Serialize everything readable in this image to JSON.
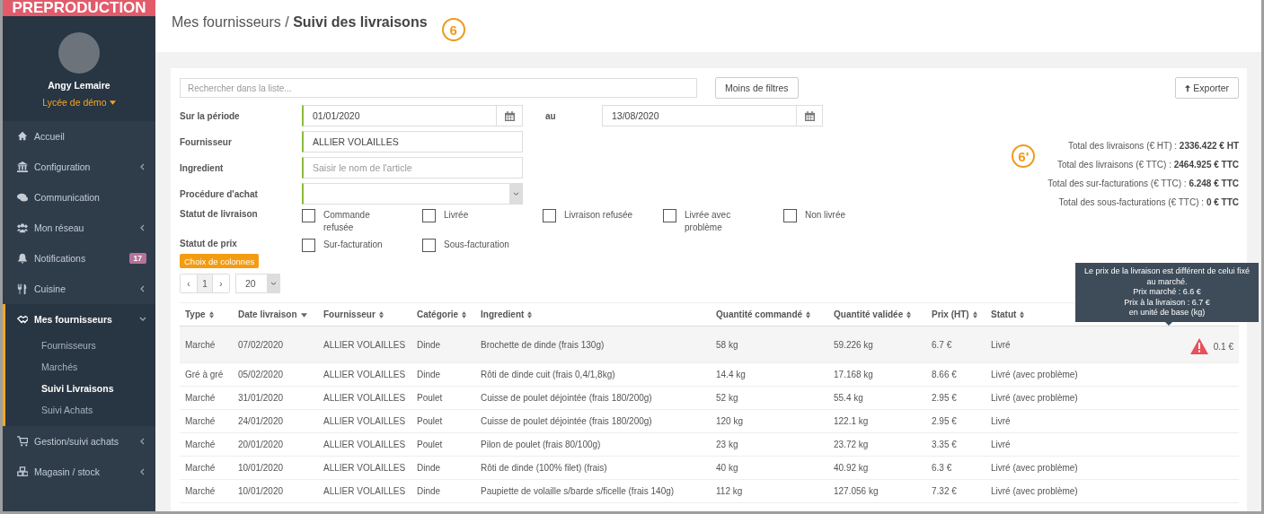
{
  "env_banner": "PREPRODUCTION",
  "user": {
    "name": "Angy Lemaire",
    "school": "Lycée de démo"
  },
  "sidebar": {
    "items": [
      {
        "kind": "home",
        "label": "Accueil",
        "has_submenu": false,
        "expanded": false
      },
      {
        "kind": "bank",
        "label": "Configuration",
        "has_submenu": true,
        "expanded": false
      },
      {
        "kind": "chat",
        "label": "Communication",
        "has_submenu": false,
        "expanded": false
      },
      {
        "kind": "users",
        "label": "Mon réseau",
        "has_submenu": true,
        "expanded": false
      },
      {
        "kind": "bell",
        "label": "Notifications",
        "has_submenu": false,
        "expanded": false,
        "badge": "17"
      },
      {
        "kind": "cutlery",
        "label": "Cuisine",
        "has_submenu": true,
        "expanded": false
      },
      {
        "kind": "handshake",
        "label": "Mes fournisseurs",
        "has_submenu": true,
        "expanded": true,
        "children": [
          {
            "label": "Fournisseurs",
            "selected": false
          },
          {
            "label": "Marchés",
            "selected": false
          },
          {
            "label": "Suivi Livraisons",
            "selected": true
          },
          {
            "label": "Suivi Achats",
            "selected": false
          }
        ]
      },
      {
        "kind": "cart",
        "label": "Gestion/suivi achats",
        "has_submenu": true,
        "expanded": false
      },
      {
        "kind": "cubes",
        "label": "Magasin / stock",
        "has_submenu": true,
        "expanded": false
      }
    ]
  },
  "breadcrumb": {
    "parent": "Mes fournisseurs / ",
    "current": "Suivi des livraisons"
  },
  "callouts": [
    "6",
    "6'"
  ],
  "search": {
    "placeholder": "Rechercher dans la liste..."
  },
  "filter_toggle": "Moins de filtres",
  "export_button": "Exporter",
  "filters": {
    "period_label": "Sur la période",
    "from": "01/01/2020",
    "to_label": "au",
    "to": "13/08/2020",
    "supplier_label": "Fournisseur",
    "supplier": "ALLIER VOLAILLES",
    "ingredient_label": "Ingredient",
    "ingredient_placeholder": "Saisir le nom de l'article",
    "procedure_label": "Procédure d'achat",
    "delivery_status_label": "Statut de livraison",
    "delivery_statuses": [
      {
        "label": "Commande refusée",
        "checked": false
      },
      {
        "label": "Livrée",
        "checked": false
      },
      {
        "label": "Livraison refusée",
        "checked": false
      },
      {
        "label": "Livrée avec problème",
        "checked": false
      },
      {
        "label": "Non livrée",
        "checked": false
      }
    ],
    "price_status_label": "Statut de prix",
    "price_statuses": [
      {
        "label": "Sur-facturation",
        "checked": false
      },
      {
        "label": "Sous-facturation",
        "checked": false
      }
    ]
  },
  "totals": [
    {
      "label": "Total des livraisons (€ HT) : ",
      "value": "2336.422 € HT"
    },
    {
      "label": "Total des livraisons (€ TTC) : ",
      "value": "2464.925 € TTC"
    },
    {
      "label": "Total des sur-facturations (€ TTC) : ",
      "value": "6.248 € TTC"
    },
    {
      "label": "Total des sous-facturations (€ TTC) : ",
      "value": "0 € TTC"
    }
  ],
  "columns_button": "Choix de colonnes",
  "pagination": {
    "prev": "‹",
    "page": "1",
    "next": "›",
    "page_size": "20"
  },
  "table": {
    "columns": [
      {
        "label": "Type",
        "sorted": false
      },
      {
        "label": "Date livraison",
        "sorted": true
      },
      {
        "label": "Fournisseur",
        "sorted": false
      },
      {
        "label": "Catégorie",
        "sorted": false
      },
      {
        "label": "Ingredient",
        "sorted": false
      },
      {
        "label": "Quantité commandé",
        "sorted": false
      },
      {
        "label": "Quantité validée",
        "sorted": false
      },
      {
        "label": "Prix (HT)",
        "sorted": false
      },
      {
        "label": "Statut",
        "sorted": false
      }
    ],
    "rows": [
      {
        "selected": true,
        "cells": [
          "Marché",
          "07/02/2020",
          "ALLIER VOLAILLES",
          "Dinde",
          "Brochette de dinde (frais 130g)",
          "58 kg",
          "59.226 kg",
          "6.7 €",
          "Livré"
        ],
        "warning": true,
        "price_gap": "0.1 €"
      },
      {
        "selected": false,
        "cells": [
          "Gré à gré",
          "05/02/2020",
          "ALLIER VOLAILLES",
          "Dinde",
          "Rôti de dinde cuit (frais 0,4/1,8kg)",
          "14.4 kg",
          "17.168 kg",
          "8.66 €",
          "Livré (avec problème)"
        ],
        "warning": false
      },
      {
        "selected": false,
        "cells": [
          "Marché",
          "31/01/2020",
          "ALLIER VOLAILLES",
          "Poulet",
          "Cuisse de poulet déjointée (frais 180/200g)",
          "52 kg",
          "55.4 kg",
          "2.95 €",
          "Livré (avec problème)"
        ],
        "warning": false
      },
      {
        "selected": false,
        "cells": [
          "Marché",
          "24/01/2020",
          "ALLIER VOLAILLES",
          "Poulet",
          "Cuisse de poulet déjointée (frais 180/200g)",
          "120 kg",
          "122.1 kg",
          "2.95 €",
          "Livré"
        ],
        "warning": false
      },
      {
        "selected": false,
        "cells": [
          "Marché",
          "20/01/2020",
          "ALLIER VOLAILLES",
          "Poulet",
          "Pilon de poulet (frais 80/100g)",
          "23 kg",
          "23.72 kg",
          "3.35 €",
          "Livré"
        ],
        "warning": false
      },
      {
        "selected": false,
        "cells": [
          "Marché",
          "10/01/2020",
          "ALLIER VOLAILLES",
          "Dinde",
          "Rôti de dinde (100% filet) (frais)",
          "40 kg",
          "40.92 kg",
          "6.3 €",
          "Livré (avec problème)"
        ],
        "warning": false
      },
      {
        "selected": false,
        "cells": [
          "Marché",
          "10/01/2020",
          "ALLIER VOLAILLES",
          "Dinde",
          "Paupiette de volaille s/barde s/ficelle (frais 140g)",
          "112 kg",
          "127.056 kg",
          "7.32 €",
          "Livré (avec problème)"
        ],
        "warning": false
      }
    ]
  },
  "tooltip": [
    "Le prix de la livraison est différent de celui fixé au marché.",
    "Prix marché : 6.6 €",
    "Prix à la livraison : 6.7 €",
    "en unité de base (kg)"
  ]
}
